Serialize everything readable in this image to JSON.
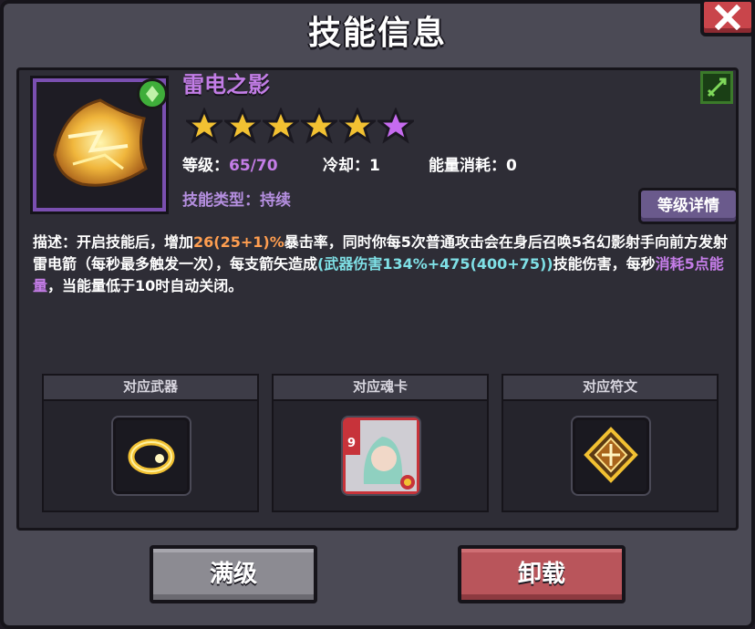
{
  "title": "技能信息",
  "skill": {
    "name": "雷电之影",
    "stars_total": 6,
    "stars_gold": 5,
    "stars_purple": 1,
    "level_label": "等级：",
    "level_value": "65/70",
    "cooldown_label": "冷却：",
    "cooldown_value": "1",
    "energy_label": "能量消耗：",
    "energy_value": "0",
    "type_label": "技能类型：",
    "type_value": "持续",
    "detail_button": "等级详情"
  },
  "description": {
    "p1": "描述：开启技能后，增加",
    "h1": "26(25+1)%",
    "p2": "暴击率，同时你每5次普通攻击会在身后召唤5名幻影射手向前方发射雷电箭（每秒最多触发一次），每支箭矢造成",
    "h2": "(武器伤害134%+475(400+75))",
    "p3": "技能伤害，每秒",
    "h3": "消耗5点能量",
    "p4": "，当能量低于10时自动关闭。"
  },
  "slots": {
    "weapon": "对应武器",
    "soul_card": "对应魂卡",
    "soul_card_level": "9",
    "rune": "对应符文"
  },
  "buttons": {
    "max_level": "满级",
    "unload": "卸载"
  },
  "colors": {
    "name_purple": "#c27de6",
    "highlight_orange": "#ff9e50",
    "highlight_cyan": "#7fe0e6",
    "star_gold": "#f2c132",
    "star_purple": "#c66bf0"
  },
  "icons": {
    "close": "close-icon",
    "skill": "lightning-leaf-icon",
    "badge": "leaf-badge-icon",
    "corner": "sword-icon",
    "weapon": "golden-bracelet-icon",
    "soul_card": "character-card-icon",
    "rune": "golden-rune-icon"
  }
}
